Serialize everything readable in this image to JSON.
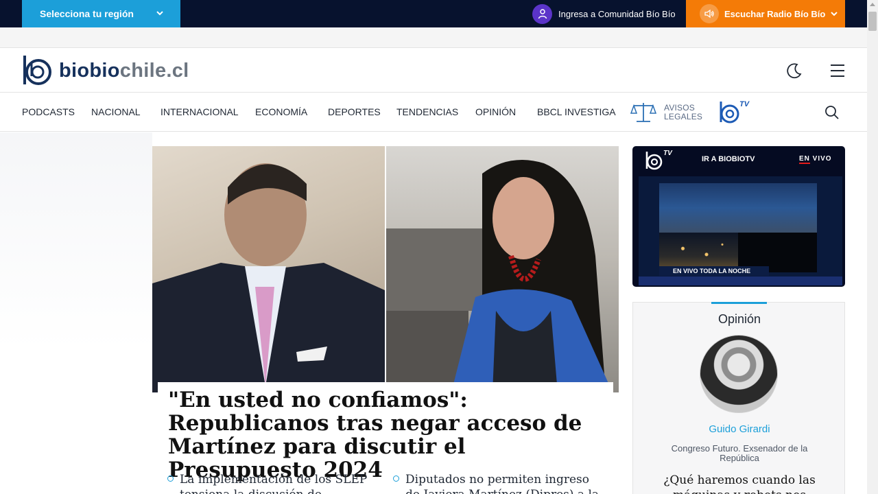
{
  "topbar": {
    "region_label": "Selecciona tu región",
    "comunidad_label": "Ingresa a Comunidad Bío Bío",
    "radio_label": "Escuchar Radio Bío Bío"
  },
  "header": {
    "logo_part1": "biobio",
    "logo_part2": "chile.cl",
    "icons": [
      "moon-icon",
      "menu-icon"
    ]
  },
  "nav": {
    "items": [
      {
        "label": "PODCASTS"
      },
      {
        "label": "NACIONAL"
      },
      {
        "label": "INTERNACIONAL"
      },
      {
        "label": "ECONOMÍA"
      },
      {
        "label": "DEPORTES"
      },
      {
        "label": "TENDENCIAS"
      },
      {
        "label": "OPINIÓN"
      },
      {
        "label": "BBCL INVESTIGA"
      }
    ],
    "avisos_line1": "AVISOS",
    "avisos_line2": "LEGALES",
    "tv_label": "TV"
  },
  "hero": {
    "headline": "\"En usted no confiamos\": Republicanos tras negar acceso de Martínez para discutir el Presupuesto 2024",
    "related": [
      {
        "text": "La implementación de los SLEP tensiona la discusión de"
      },
      {
        "text": "Diputados no permiten ingreso de Javiera Martínez (Dipres) a la"
      }
    ]
  },
  "tv_box": {
    "tv_label": "TV",
    "link_label": "IR A BIOBIOTV",
    "live_en": "EN",
    "live_vivo": " VIVO",
    "banner_text": "EN VIVO TODA LA NOCHE"
  },
  "opinion": {
    "title": "Opinión",
    "name": "Guido Girardi",
    "role": "Congreso Futuro. Exsenador de la República",
    "question": "¿Qué haremos cuando las máquinas y robots nos"
  },
  "colors": {
    "topbar": "#07122e",
    "region": "#1c9fd9",
    "radio": "#f47b07",
    "comunidad_avatar": "#5b34c9",
    "brand_dark": "#16315c",
    "accent": "#1c9fd9"
  }
}
